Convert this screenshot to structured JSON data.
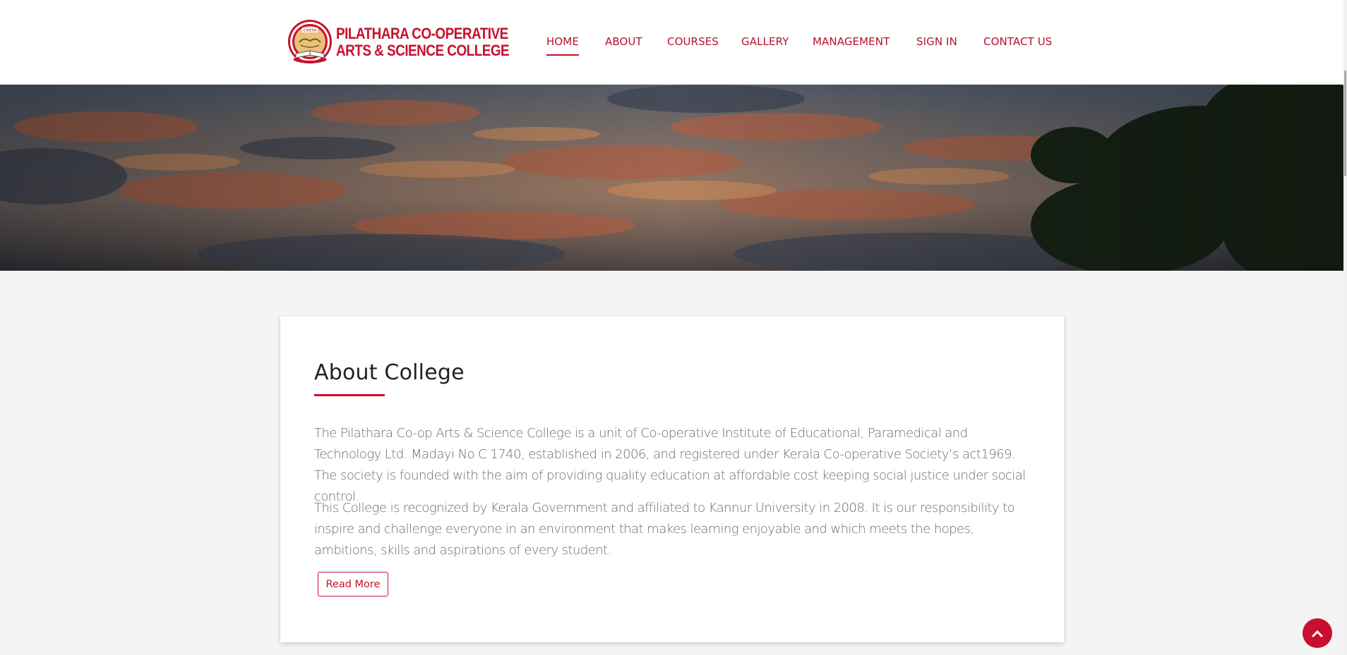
{
  "brand": {
    "name_line1": "PILATHARA CO-OPERATIVE",
    "name_line2": "ARTS & SCIENCE COLLEGE",
    "seal_text": "CIPETM",
    "accent_color": "#c8102e"
  },
  "nav": {
    "items": [
      {
        "label": "HOME",
        "active": true
      },
      {
        "label": "ABOUT",
        "active": false
      },
      {
        "label": "COURSES",
        "active": false
      },
      {
        "label": "GALLERY",
        "active": false
      },
      {
        "label": "MANAGEMENT",
        "active": false
      },
      {
        "label": "SIGN IN",
        "active": false
      },
      {
        "label": "CONTACT US",
        "active": false
      }
    ]
  },
  "hero": {
    "image": "sunset-clouds-with-tree-silhouette"
  },
  "about": {
    "title": "About College",
    "paragraph1": "The Pilathara Co-op Arts & Science College is a unit of Co-operative Institute of Educational, Paramedical and Technology Ltd. Madayi No C 1740, established in 2006, and registered under Kerala Co-operative Society’s act1969. The society is founded with the aim of providing quality education at affordable cost keeping social justice under social control.",
    "paragraph2": "This College is recognized by Kerala Government and affiliated to Kannur University in 2008. It is our responsibility to inspire and challenge everyone in an environment that makes learning enjoyable and which meets the hopes, ambitions, skills and aspirations of every student.",
    "read_more_label": "Read More"
  },
  "icons": {
    "back_to_top": "chevron-up-icon"
  }
}
